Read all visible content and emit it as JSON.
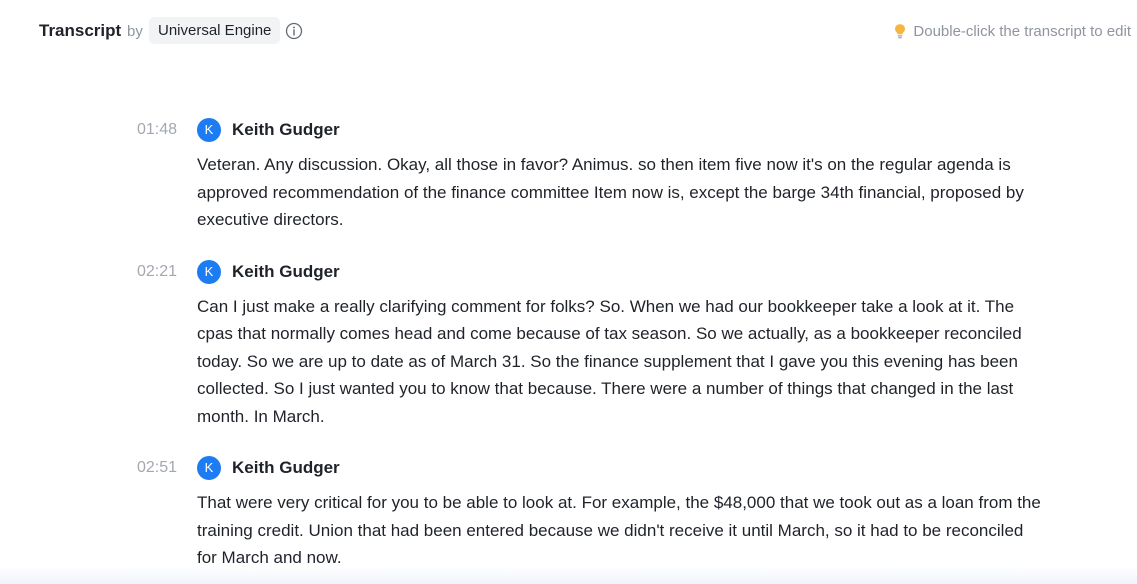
{
  "header": {
    "title": "Transcript",
    "by": "by",
    "engine": "Universal Engine",
    "hint": "Double-click the transcript to edit"
  },
  "icons": {
    "info": "info-icon",
    "hint": "lightbulb-icon"
  },
  "colors": {
    "accent": "#1e7cf2",
    "muted": "#8f959e",
    "hint_bulb": "#f5b640"
  },
  "segments": [
    {
      "time": "01:48",
      "avatar": "K",
      "speaker": "Keith Gudger",
      "text": "Veteran. Any discussion. Okay, all those in favor? Animus. so then item five now it's on the regular agenda is approved recommendation of the finance committee Item now is, except the barge 34th financial, proposed by executive directors."
    },
    {
      "time": "02:21",
      "avatar": "K",
      "speaker": "Keith Gudger",
      "text": "Can I just make a really clarifying comment for folks? So. When we had our bookkeeper take a look at it. The cpas that normally comes head and come because of tax season. So we actually, as a bookkeeper reconciled today. So we are up to date as of March 31. So the finance supplement that I gave you this evening has been collected. So I just wanted you to know that because. There were a number of things that changed in the last month. In March."
    },
    {
      "time": "02:51",
      "avatar": "K",
      "speaker": "Keith Gudger",
      "text": "That were very critical for you to be able to look at. For example, the $48,000 that we took out as a loan from the training credit. Union that had been entered because we didn't receive it until March, so it had to be reconciled for March and now."
    }
  ]
}
